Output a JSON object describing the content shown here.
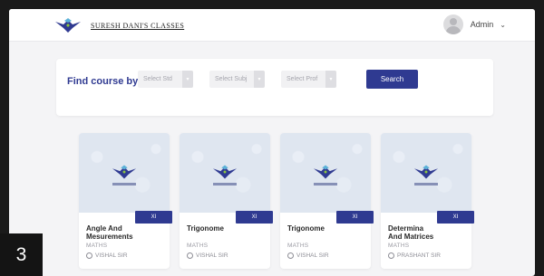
{
  "header": {
    "brand": "SURESH DANI'S CLASSES",
    "user_name": "Admin",
    "caret": "⌄"
  },
  "find": {
    "title": "Find course by",
    "std_placeholder": "Select Std",
    "subj_placeholder": "Select Subj",
    "prof_placeholder": "Select Prof",
    "search_label": "Search"
  },
  "courses": [
    {
      "title": "Angle And\nMesurements",
      "subject": "MATHS",
      "professor": "VISHAL SIR",
      "std": "XI"
    },
    {
      "title": "Trigonome",
      "subject": "MATHS",
      "professor": "VISHAL SIR",
      "std": "XI"
    },
    {
      "title": "Trigonome",
      "subject": "MATHS",
      "professor": "VISHAL SIR",
      "std": "XI"
    },
    {
      "title": "Determina\nAnd Matrices",
      "subject": "MATHS",
      "professor": "PRASHANT SIR",
      "std": "XI"
    }
  ],
  "step_number": "3",
  "colors": {
    "accent": "#2f3a91",
    "background": "#f4f4f6",
    "card": "#ffffff"
  }
}
